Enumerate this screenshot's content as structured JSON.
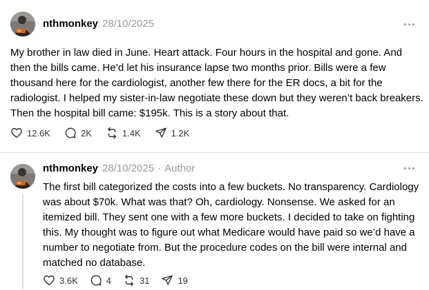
{
  "posts": [
    {
      "username": "nthmonkey",
      "timestamp": "28/10/2025",
      "is_author": false,
      "text": "My brother in law died in June. Heart attack. Four hours in the hospital and gone. And then the bills came. He’d let his insurance lapse two months prior. Bills were a few thousand here for the cardiologist, another few there for the ER docs, a bit for the radiologist. I helped my sister-in-law negotiate these down but they weren’t back breakers. Then the hospital bill came: $195k. This is a story about that.",
      "likes": "12.6K",
      "replies": "2K",
      "reposts": "1.4K",
      "shares": "1.2K"
    },
    {
      "username": "nthmonkey",
      "timestamp": "28/10/2025",
      "is_author": true,
      "separator": "·",
      "author_label": "Author",
      "text": "The first bill categorized the costs into a few buckets. No transparency. Cardiology was about $70k. What was that? Oh, cardiology. Nonsense. We asked for an itemized bill. They sent one with a few more buckets. I decided to take on fighting this. My thought was to figure out what Medicare would have paid so we’d have a number to negotiate from. But the procedure codes on the bill were internal and matched no database.",
      "likes": "3.6K",
      "replies": "4",
      "reposts": "31",
      "shares": "19"
    }
  ],
  "icons": {
    "avatar": "profile-photo",
    "more": "more-horizontal-icon",
    "like": "heart-icon",
    "reply": "comment-bubble-icon",
    "repost": "repost-arrows-icon",
    "share": "send-paper-plane-icon"
  },
  "colors": {
    "text": "#000000",
    "muted": "#999999",
    "counts": "#333333",
    "divider": "#e3e3e3",
    "thread_line": "#dcdcdc"
  }
}
